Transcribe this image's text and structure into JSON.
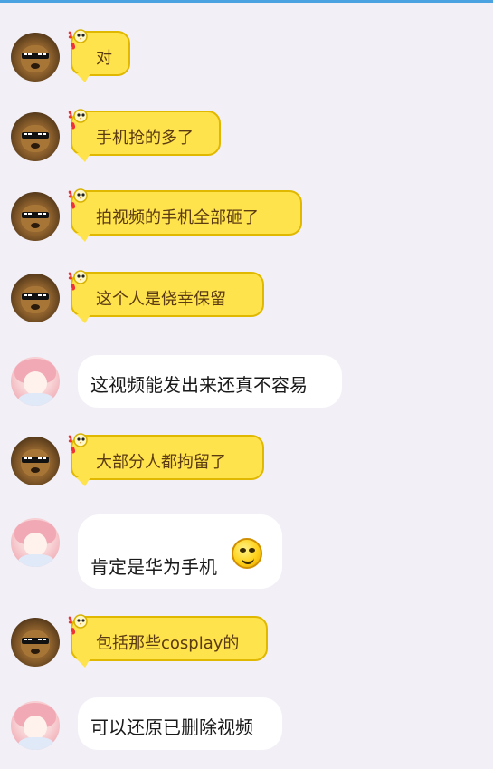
{
  "messages": [
    {
      "sender": "dog",
      "style": "yellow",
      "text": "对"
    },
    {
      "sender": "dog",
      "style": "yellow",
      "text": "手机抢的多了"
    },
    {
      "sender": "dog",
      "style": "yellow",
      "text": "拍视频的手机全部砸了"
    },
    {
      "sender": "dog",
      "style": "yellow",
      "text": "这个人是侥幸保留"
    },
    {
      "sender": "girl",
      "style": "white",
      "text": "这视频能发出来还真不容易"
    },
    {
      "sender": "dog",
      "style": "yellow",
      "text": "大部分人都拘留了"
    },
    {
      "sender": "girl",
      "style": "white",
      "text": "肯定是华为手机",
      "emoji": "smirk-emoji-icon"
    },
    {
      "sender": "dog",
      "style": "yellow",
      "text": "包括那些cosplay的"
    },
    {
      "sender": "girl",
      "style": "white",
      "text": "可以还原已删除视频"
    }
  ],
  "colors": {
    "background": "#f2eff6",
    "yellow_bubble": "#ffe34d",
    "yellow_border": "#e0b800",
    "white_bubble": "#ffffff",
    "top_accent": "#4aa3e0"
  }
}
